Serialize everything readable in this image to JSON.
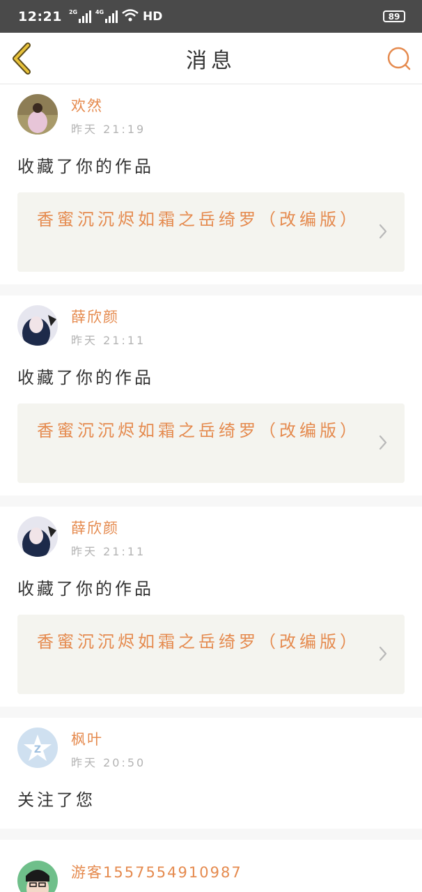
{
  "status_bar": {
    "time": "12:21",
    "net1": "2G",
    "net2": "4G",
    "hd": "HD",
    "battery": "89"
  },
  "nav": {
    "title": "消息",
    "back_icon": "chevron-left-icon",
    "search_icon": "search-icon"
  },
  "colors": {
    "accent": "#e58a4e",
    "back_icon": "#e8c23b",
    "card_bg": "#f4f4ef"
  },
  "messages": [
    {
      "user": "欢然",
      "time": "昨天 21:19",
      "action": "收藏了你的作品",
      "work": "香蜜沉沉烬如霜之岳绮罗（改编版）"
    },
    {
      "user": "薛欣颜",
      "time": "昨天 21:11",
      "action": "收藏了你的作品",
      "work": "香蜜沉沉烬如霜之岳绮罗（改编版）"
    },
    {
      "user": "薛欣颜",
      "time": "昨天 21:11",
      "action": "收藏了你的作品",
      "work": "香蜜沉沉烬如霜之岳绮罗（改编版）"
    },
    {
      "user": "枫叶",
      "time": "昨天 20:50",
      "action": "关注了您"
    },
    {
      "user": "游客15575549​10987"
    }
  ]
}
